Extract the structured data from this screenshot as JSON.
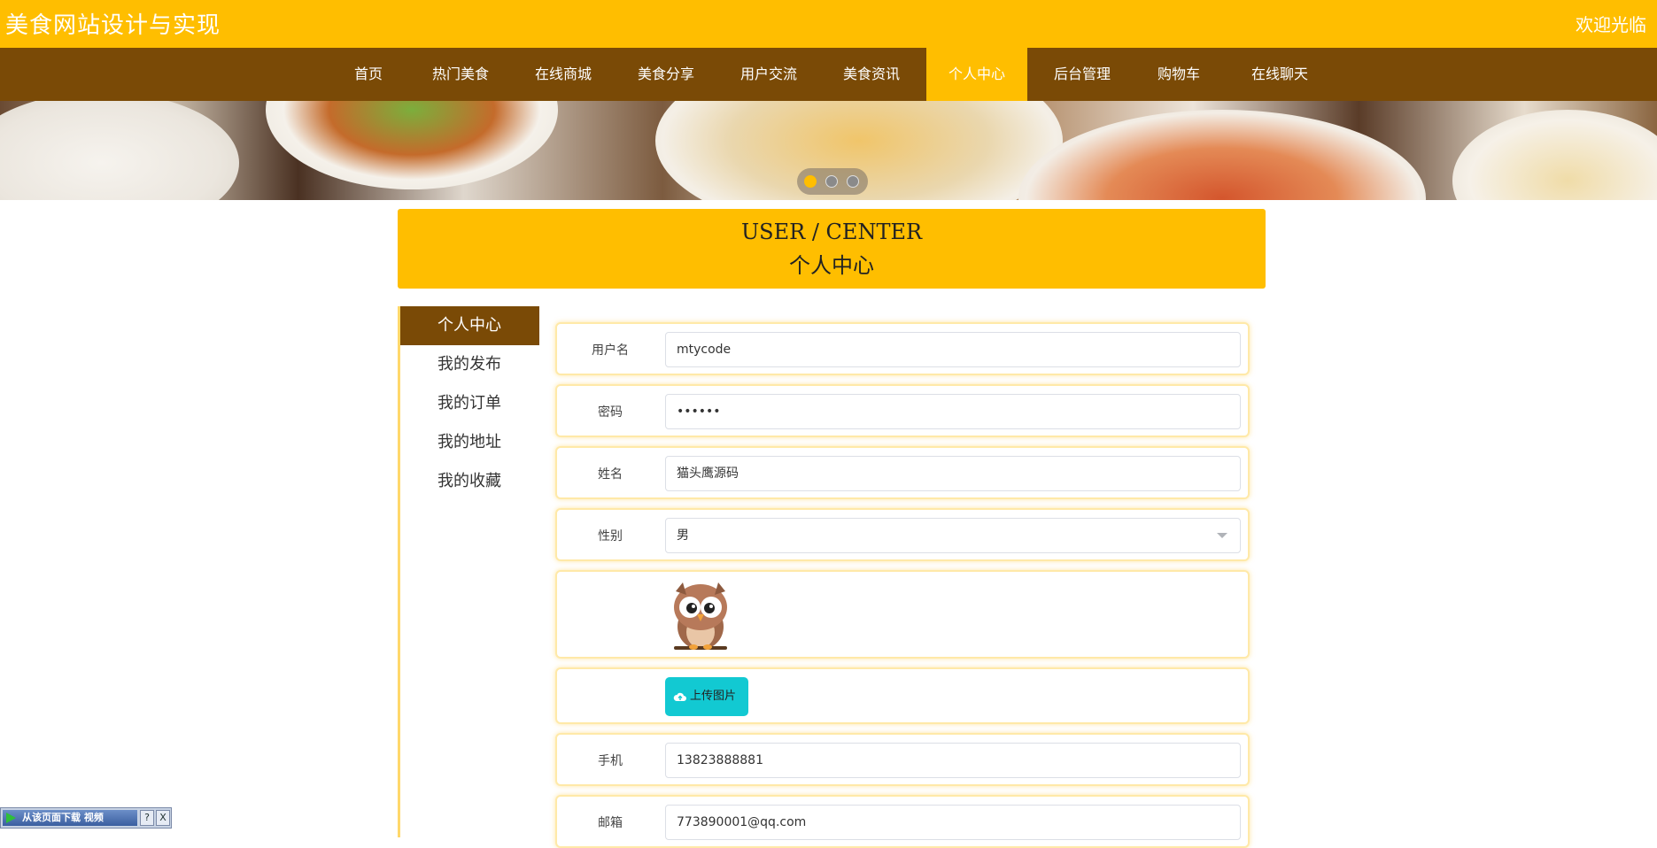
{
  "header": {
    "site_title": "美食网站设计与实现",
    "welcome": "欢迎光临"
  },
  "nav": {
    "items": [
      {
        "label": "首页"
      },
      {
        "label": "热门美食"
      },
      {
        "label": "在线商城"
      },
      {
        "label": "美食分享"
      },
      {
        "label": "用户交流"
      },
      {
        "label": "美食资讯"
      },
      {
        "label": "个人中心",
        "active": true
      },
      {
        "label": "后台管理"
      },
      {
        "label": "购物车"
      },
      {
        "label": "在线聊天"
      }
    ]
  },
  "banner": {
    "slide_count": 3,
    "active_slide": 1
  },
  "center_header": {
    "en": "USER / CENTER",
    "cn": "个人中心"
  },
  "sidemenu": {
    "items": [
      {
        "label": "个人中心",
        "active": true
      },
      {
        "label": "我的发布"
      },
      {
        "label": "我的订单"
      },
      {
        "label": "我的地址"
      },
      {
        "label": "我的收藏"
      }
    ]
  },
  "form": {
    "username": {
      "label": "用户名",
      "value": "mtycode"
    },
    "password": {
      "label": "密码",
      "value": "••••••"
    },
    "name": {
      "label": "姓名",
      "value": "猫头鹰源码"
    },
    "gender": {
      "label": "性别",
      "value": "男"
    },
    "avatar": {
      "icon": "owl-avatar"
    },
    "upload_button": {
      "label": "上传图片",
      "icon": "cloud-upload-icon"
    },
    "phone": {
      "label": "手机",
      "value": "13823888881"
    },
    "email": {
      "label": "邮箱",
      "value": "773890001@qq.com"
    }
  },
  "download_widget": {
    "label": "从该页面下载 视频",
    "help": "?",
    "close": "X"
  },
  "colors": {
    "accent": "#ffbe00",
    "nav_bg": "#7a4a06",
    "upload_button": "#12c9d2"
  }
}
